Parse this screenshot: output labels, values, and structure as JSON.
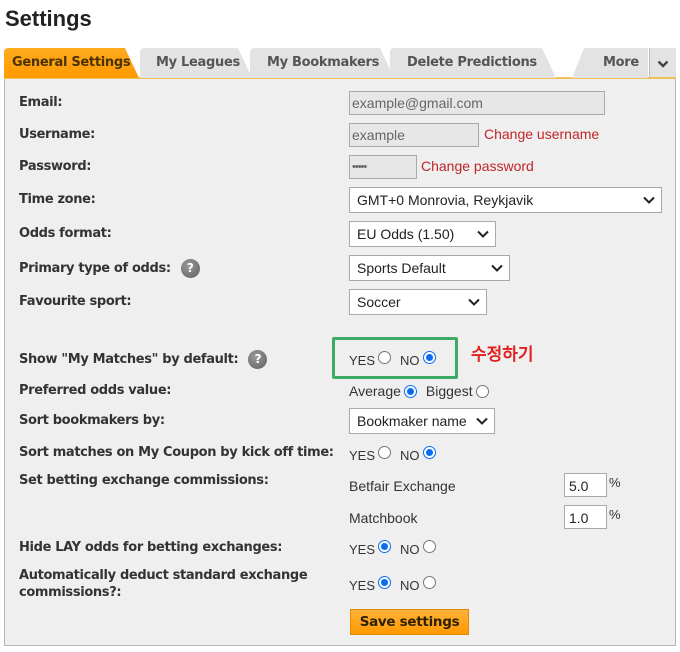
{
  "page": {
    "title": "Settings"
  },
  "tabs": [
    {
      "label": "General Settings",
      "active": true
    },
    {
      "label": "My Leagues",
      "active": false
    },
    {
      "label": "My Bookmakers",
      "active": false
    },
    {
      "label": "Delete Predictions",
      "active": false
    },
    {
      "label": "More",
      "active": false
    }
  ],
  "form": {
    "email": {
      "label": "Email:",
      "value": "example@gmail.com"
    },
    "username": {
      "label": "Username:",
      "value": "example",
      "link": "Change username"
    },
    "password": {
      "label": "Password:",
      "value": "•••••",
      "link": "Change password"
    },
    "timezone": {
      "label": "Time zone:",
      "selected": "GMT+0 Monrovia, Reykjavik"
    },
    "odds_format": {
      "label": "Odds format:",
      "selected": "EU Odds (1.50)"
    },
    "primary_odds": {
      "label": "Primary type of odds:",
      "selected": "Sports Default"
    },
    "favourite_sport": {
      "label": "Favourite sport:",
      "selected": "Soccer"
    },
    "show_my_matches": {
      "label": "Show \"My Matches\" by default:",
      "options": [
        "YES",
        "NO"
      ],
      "selected": "NO"
    },
    "preferred_odds": {
      "label": "Preferred odds value:",
      "options": [
        "Average",
        "Biggest"
      ],
      "selected": "Average"
    },
    "sort_bookmakers": {
      "label": "Sort bookmakers by:",
      "selected": "Bookmaker name"
    },
    "sort_matches": {
      "label": "Sort matches on My Coupon by kick off time:",
      "options": [
        "YES",
        "NO"
      ],
      "selected": "NO"
    },
    "commissions": {
      "label": "Set betting exchange commissions:",
      "exchanges": [
        {
          "name": "Betfair Exchange",
          "value": "5.0",
          "unit": "%"
        },
        {
          "name": "Matchbook",
          "value": "1.0",
          "unit": "%"
        }
      ]
    },
    "hide_lay": {
      "label": "Hide LAY odds for betting exchanges:",
      "options": [
        "YES",
        "NO"
      ],
      "selected": "YES"
    },
    "auto_deduct": {
      "label_line1": "Automatically deduct standard exchange",
      "label_line2": "commissions?:",
      "options": [
        "YES",
        "NO"
      ],
      "selected": "YES"
    },
    "save_label": "Save settings"
  },
  "annotation": {
    "text": "수정하기",
    "box_color": "#3daa66",
    "text_color": "#e02020"
  },
  "colors": {
    "accent": "#ff9d00",
    "link": "#c0262a",
    "radio": "#0a6cf0"
  }
}
